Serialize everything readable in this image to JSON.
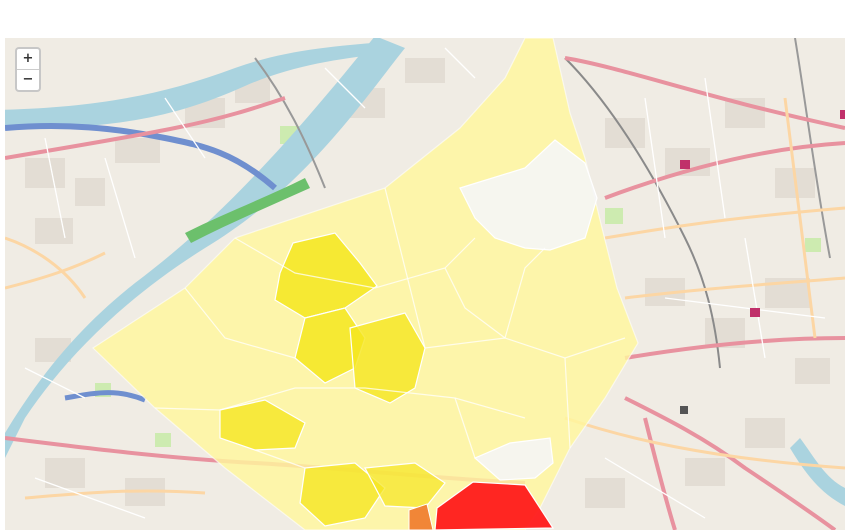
{
  "page": {
    "caption": ""
  },
  "controls": {
    "zoom_in_label": "+",
    "zoom_out_label": "−"
  },
  "map": {
    "basemap": "OpenStreetMap",
    "colors": {
      "land": "#f2efe9",
      "water": "#aad3df",
      "park": "#cdebb0",
      "major_road": "#e8929f",
      "secondary_road": "#fcd6a4",
      "railway": "#999999",
      "choropleth_light": "#fff7a8",
      "choropleth_medium": "#f5e61f",
      "choropleth_high": "#ff1a1a",
      "choropleth_none": "#f5f5f5"
    },
    "legend": []
  }
}
